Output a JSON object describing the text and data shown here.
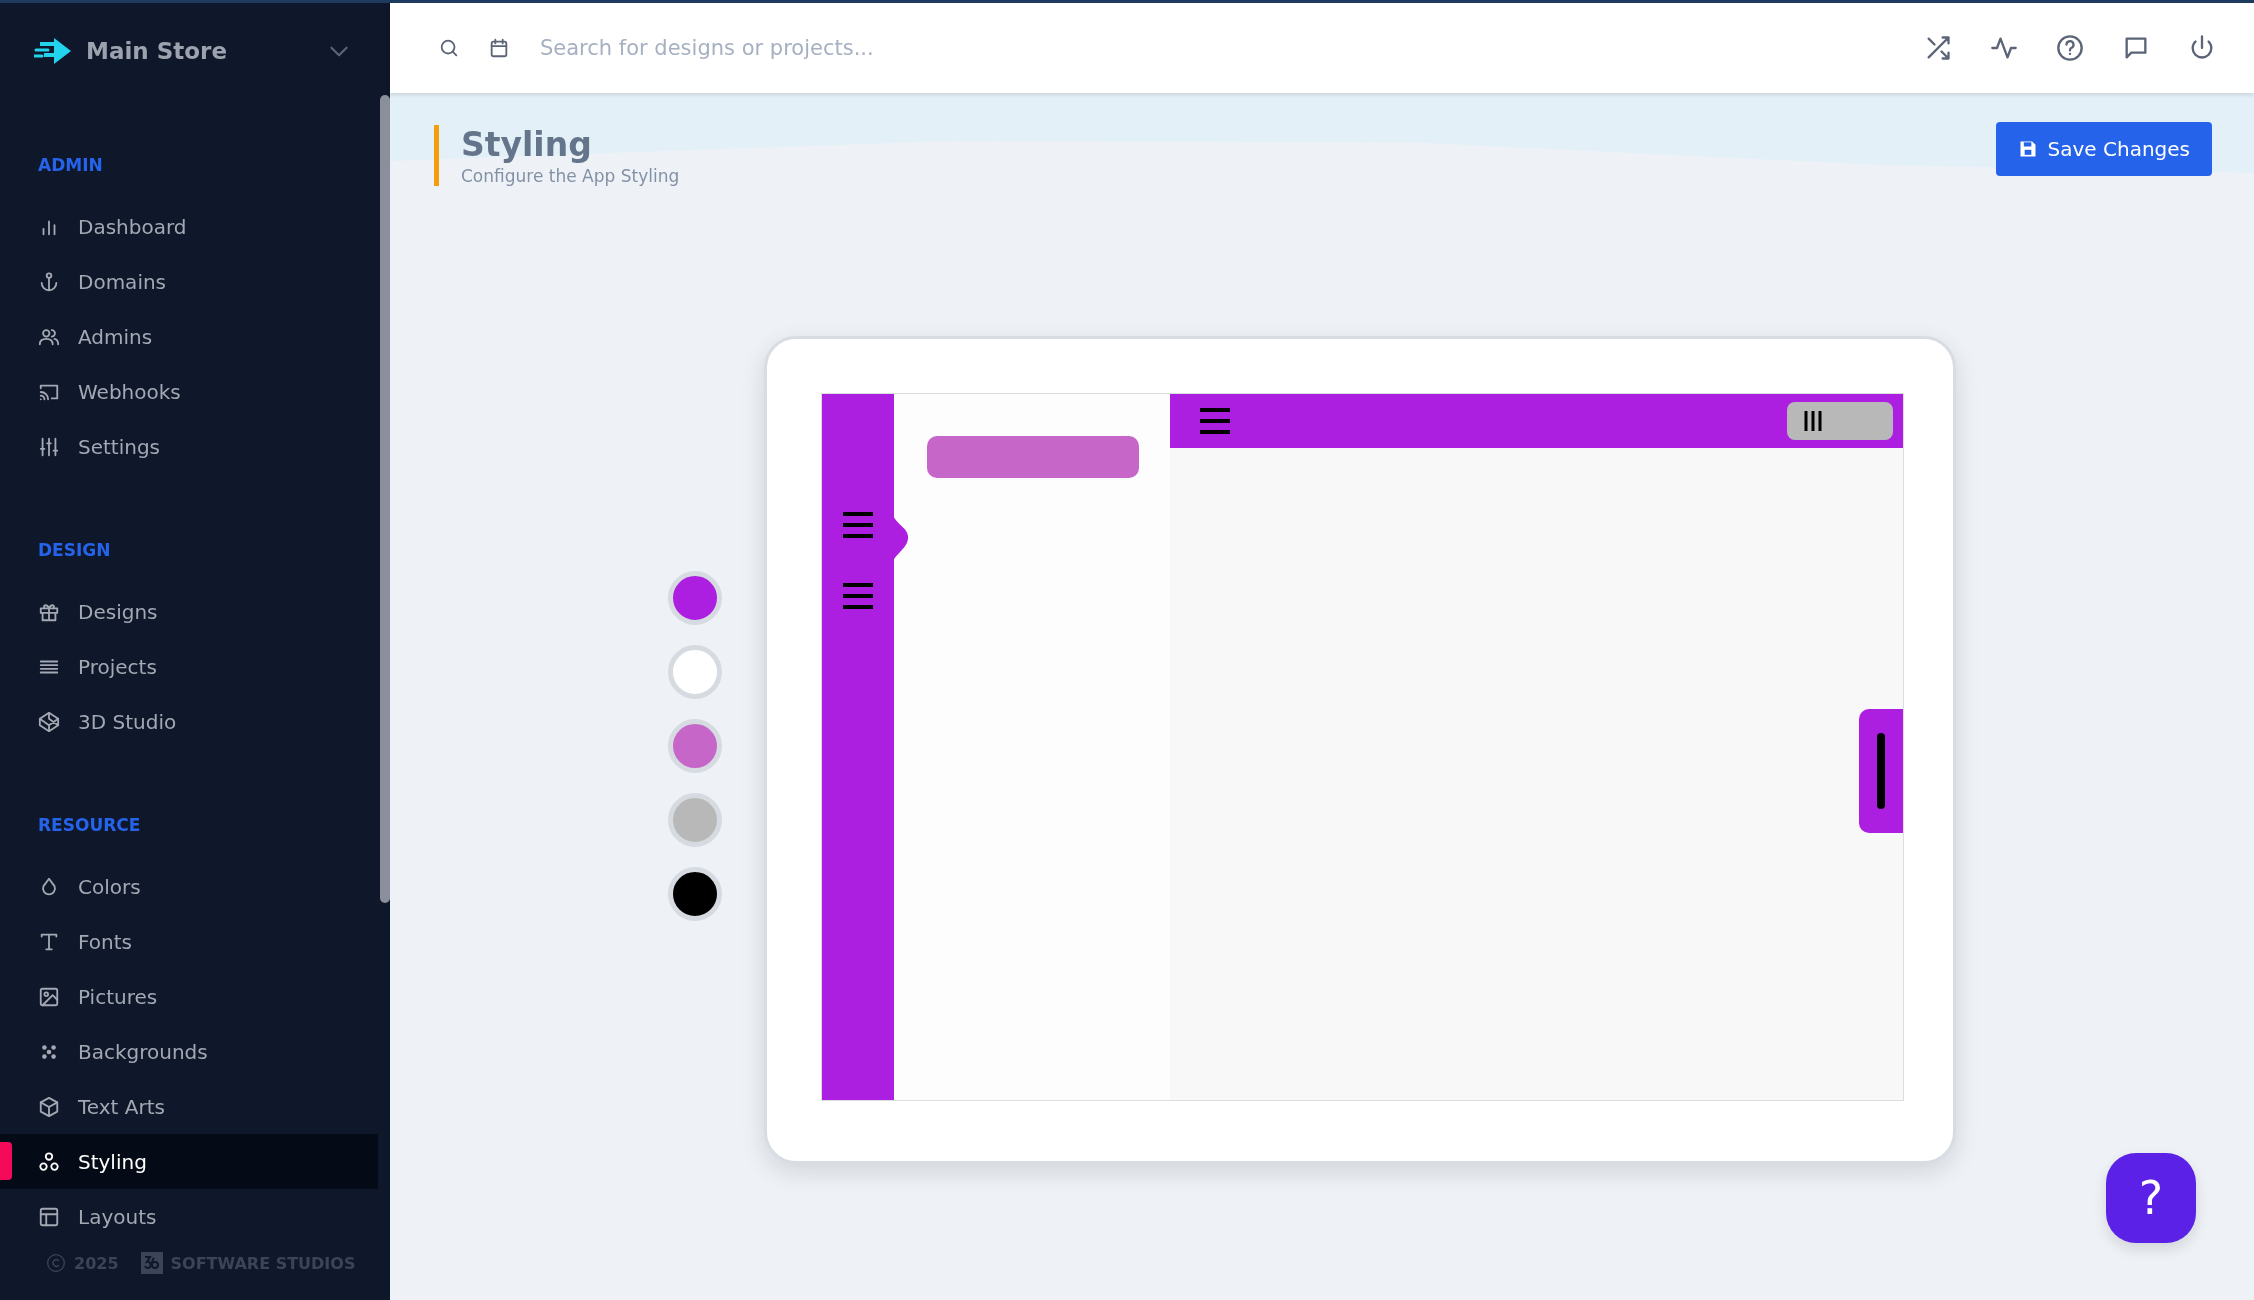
{
  "sidebar": {
    "store": {
      "name": "Main Store"
    },
    "sections": [
      {
        "title": "ADMIN",
        "items": [
          {
            "label": "Dashboard",
            "selected": false
          },
          {
            "label": "Domains",
            "selected": false
          },
          {
            "label": "Admins",
            "selected": false
          },
          {
            "label": "Webhooks",
            "selected": false
          },
          {
            "label": "Settings",
            "selected": false
          }
        ]
      },
      {
        "title": "DESIGN",
        "items": [
          {
            "label": "Designs",
            "selected": false
          },
          {
            "label": "Projects",
            "selected": false
          },
          {
            "label": "3D Studio",
            "selected": false
          }
        ]
      },
      {
        "title": "RESOURCE",
        "items": [
          {
            "label": "Colors",
            "selected": false
          },
          {
            "label": "Fonts",
            "selected": false
          },
          {
            "label": "Pictures",
            "selected": false
          },
          {
            "label": "Backgrounds",
            "selected": false
          },
          {
            "label": "Text Arts",
            "selected": false
          },
          {
            "label": "Styling",
            "selected": true
          },
          {
            "label": "Layouts",
            "selected": false
          }
        ]
      }
    ],
    "footer": {
      "year": "2025",
      "company": "SOFTWARE STUDIOS"
    }
  },
  "topbar": {
    "search": {
      "placeholder": "Search for designs or projects..."
    }
  },
  "page": {
    "title": "Styling",
    "subtitle": "Configure the App Styling",
    "save_button": "Save Changes"
  },
  "swatches": [
    {
      "color": "#ad1fe0"
    },
    {
      "color": "#ffffff"
    },
    {
      "color": "#c766c9"
    },
    {
      "color": "#b8b8b8"
    },
    {
      "color": "#000000"
    }
  ],
  "help_button": "?"
}
